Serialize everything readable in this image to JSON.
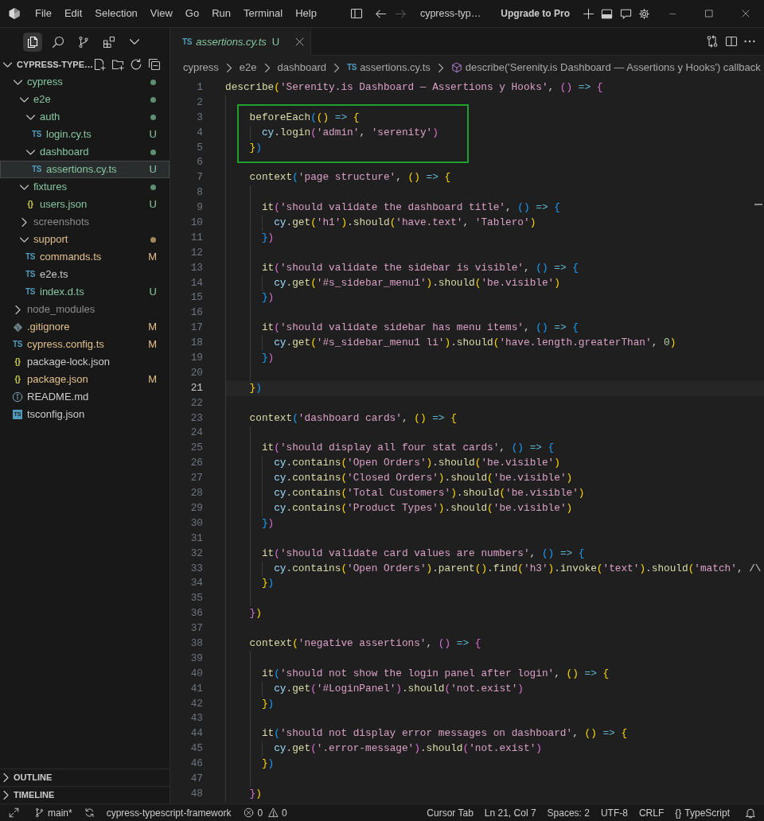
{
  "title_bar": {
    "menus": [
      "File",
      "Edit",
      "Selection",
      "View",
      "Go",
      "Run",
      "Terminal",
      "Help"
    ],
    "nav": [
      {
        "kind": "back",
        "disabled": false
      },
      {
        "kind": "forward",
        "disabled": true
      }
    ],
    "title": "cypress-typ…",
    "upgrade": "Upgrade to Pro"
  },
  "sidebar": {
    "views": [
      {
        "selected": true
      },
      {
        "selected": false
      },
      {
        "selected": false
      },
      {
        "selected": false
      }
    ],
    "section": {
      "title": "CYPRESS-TYPE…",
      "expanded": true
    },
    "tree": [
      {
        "name": "cypress",
        "kind": "folder",
        "expanded": true,
        "color": "#86c6a0",
        "dot": {
          "color": "#5f8f72"
        },
        "selected": false,
        "children": [
          {
            "name": "e2e",
            "kind": "folder",
            "expanded": true,
            "color": "#86c6a0",
            "dot": {
              "color": "#5f8f72"
            },
            "selected": false,
            "children": [
              {
                "name": "auth",
                "kind": "folder",
                "expanded": true,
                "color": "#86c6a0",
                "dot": {
                  "color": "#5f8f72"
                },
                "selected": false,
                "children": [
                  {
                    "name": "login.cy.ts",
                    "kind": "ts",
                    "glyph": "TS",
                    "color": "#86c6a0",
                    "badge": "U",
                    "selected": false
                  }
                ]
              },
              {
                "name": "dashboard",
                "kind": "folder",
                "expanded": true,
                "color": "#86c6a0",
                "dot": {
                  "color": "#5f8f72"
                },
                "selected": false,
                "children": [
                  {
                    "name": "assertions.cy.ts",
                    "kind": "ts",
                    "glyph": "TS",
                    "color": "#86c6a0",
                    "badge": "U",
                    "selected": true
                  }
                ]
              }
            ]
          },
          {
            "name": "fixtures",
            "kind": "folder",
            "expanded": true,
            "color": "#86c6a0",
            "dot": {
              "color": "#5f8f72"
            },
            "selected": false,
            "children": [
              {
                "name": "users.json",
                "kind": "json",
                "glyph": "{}",
                "color": "#86c6a0",
                "badge": "U",
                "selected": false
              }
            ]
          },
          {
            "name": "screenshots",
            "kind": "folder",
            "expanded": false,
            "color": "#8c8c8c",
            "selected": false
          },
          {
            "name": "support",
            "kind": "folder",
            "expanded": true,
            "color": "#e2c08d",
            "dot": {
              "color": "#a08a5c"
            },
            "selected": false,
            "children": [
              {
                "name": "commands.ts",
                "kind": "ts",
                "glyph": "TS",
                "color": "#e2c08d",
                "badge": "M",
                "selected": false
              },
              {
                "name": "e2e.ts",
                "kind": "ts",
                "glyph": "TS",
                "color": "#cccccc",
                "selected": false
              },
              {
                "name": "index.d.ts",
                "kind": "ts",
                "glyph": "TS",
                "color": "#86c6a0",
                "badge": "U",
                "selected": false
              }
            ]
          }
        ]
      },
      {
        "name": "node_modules",
        "kind": "folder",
        "expanded": false,
        "color": "#8c8c8c",
        "selected": false
      },
      {
        "name": ".gitignore",
        "kind": "git",
        "color": "#e2c08d",
        "badge": "M",
        "selected": false
      },
      {
        "name": "cypress.config.ts",
        "kind": "ts",
        "glyph": "TS",
        "color": "#e2c08d",
        "badge": "M",
        "selected": false
      },
      {
        "name": "package-lock.json",
        "kind": "json",
        "glyph": "{}",
        "color": "#cccccc",
        "selected": false
      },
      {
        "name": "package.json",
        "kind": "json",
        "glyph": "{}",
        "color": "#e2c08d",
        "badge": "M",
        "selected": false
      },
      {
        "name": "README.md",
        "kind": "info",
        "color": "#cccccc",
        "selected": false
      },
      {
        "name": "tsconfig.json",
        "kind": "tsconfig",
        "glyph": "TS",
        "color": "#cccccc",
        "selected": false
      }
    ],
    "panels": [
      {
        "title": "OUTLINE",
        "expanded": false
      },
      {
        "title": "TIMELINE",
        "expanded": false
      }
    ]
  },
  "editor": {
    "tabs": [
      {
        "glyph": "TS",
        "label": "assertions.cy.ts",
        "status": "U",
        "color": "#86c6a0",
        "preview": true,
        "selected": true
      }
    ],
    "breadcrumb": [
      {
        "kind": "folder",
        "label": "cypress"
      },
      {
        "kind": "folder",
        "label": "e2e"
      },
      {
        "kind": "folder",
        "label": "dashboard"
      },
      {
        "kind": "file",
        "glyph": "TS",
        "label": "assertions.cy.ts"
      },
      {
        "kind": "symbol",
        "label": "describe('Serenity.is Dashboard — Assertions y Hooks') callback"
      }
    ],
    "lines": [
      {
        "kind": "line",
        "number": "1",
        "text": "describe('Serenity.is Dashboard — Assertions y Hooks', () => {",
        "active": false
      },
      {
        "kind": "line",
        "number": "2",
        "active": false
      },
      {
        "kind": "frame",
        "lines": [
          {
            "number": "3",
            "text": "    beforeEach(() => {",
            "active": false
          },
          {
            "number": "4",
            "text": "      cy.login('admin', 'serenity')",
            "active": false
          },
          {
            "number": "5",
            "text": "    })",
            "active": false
          }
        ]
      },
      {
        "kind": "line",
        "number": "6",
        "active": false
      },
      {
        "kind": "line",
        "number": "7",
        "text": "    context('page structure', () => {",
        "active": false
      },
      {
        "kind": "line",
        "number": "8",
        "active": false
      },
      {
        "kind": "line",
        "number": "9",
        "text": "      it('should validate the dashboard title', () => {",
        "active": false
      },
      {
        "kind": "line",
        "number": "10",
        "text": "        cy.get('h1').should('have.text', 'Tablero')",
        "active": false
      },
      {
        "kind": "line",
        "number": "11",
        "text": "      })",
        "active": false
      },
      {
        "kind": "line",
        "number": "12",
        "active": false
      },
      {
        "kind": "line",
        "number": "13",
        "text": "      it('should validate the sidebar is visible', () => {",
        "active": false
      },
      {
        "kind": "line",
        "number": "14",
        "text": "        cy.get('#s_sidebar_menu1').should('be.visible')",
        "active": false
      },
      {
        "kind": "line",
        "number": "15",
        "text": "      })",
        "active": false
      },
      {
        "kind": "line",
        "number": "16",
        "active": false
      },
      {
        "kind": "line",
        "number": "17",
        "text": "      it('should validate sidebar has menu items', () => {",
        "active": false
      },
      {
        "kind": "line",
        "number": "18",
        "text": "        cy.get('#s_sidebar_menu1 li').should('have.length.greaterThan', 0)",
        "active": false
      },
      {
        "kind": "line",
        "number": "19",
        "text": "      })",
        "active": false
      },
      {
        "kind": "line",
        "number": "20",
        "active": false
      },
      {
        "kind": "line",
        "number": "21",
        "text": "    })",
        "active": true
      },
      {
        "kind": "line",
        "number": "22",
        "active": false
      },
      {
        "kind": "line",
        "number": "23",
        "text": "    context('dashboard cards', () => {",
        "active": false
      },
      {
        "kind": "line",
        "number": "24",
        "active": false
      },
      {
        "kind": "line",
        "number": "25",
        "text": "      it('should display all four stat cards', () => {",
        "active": false
      },
      {
        "kind": "line",
        "number": "26",
        "text": "        cy.contains('Open Orders').should('be.visible')",
        "active": false
      },
      {
        "kind": "line",
        "number": "27",
        "text": "        cy.contains('Closed Orders').should('be.visible')",
        "active": false
      },
      {
        "kind": "line",
        "number": "28",
        "text": "        cy.contains('Total Customers').should('be.visible')",
        "active": false
      },
      {
        "kind": "line",
        "number": "29",
        "text": "        cy.contains('Product Types').should('be.visible')",
        "active": false
      },
      {
        "kind": "line",
        "number": "30",
        "text": "      })",
        "active": false
      },
      {
        "kind": "line",
        "number": "31",
        "active": false
      },
      {
        "kind": "line",
        "number": "32",
        "text": "      it('should validate card values are numbers', () => {",
        "active": false
      },
      {
        "kind": "line",
        "number": "33",
        "text": "        cy.contains('Open Orders').parent().find('h3').invoke('text').should('match', /\\",
        "active": false
      },
      {
        "kind": "line",
        "number": "34",
        "text": "      })",
        "active": false
      },
      {
        "kind": "line",
        "number": "35",
        "active": false
      },
      {
        "kind": "line",
        "number": "36",
        "text": "    })",
        "active": false
      },
      {
        "kind": "line",
        "number": "37",
        "active": false
      },
      {
        "kind": "line",
        "number": "38",
        "text": "    context('negative assertions', () => {",
        "active": false
      },
      {
        "kind": "line",
        "number": "39",
        "active": false
      },
      {
        "kind": "line",
        "number": "40",
        "text": "      it('should not show the login panel after login', () => {",
        "active": false
      },
      {
        "kind": "line",
        "number": "41",
        "text": "        cy.get('#LoginPanel').should('not.exist')",
        "active": false
      },
      {
        "kind": "line",
        "number": "42",
        "text": "      })",
        "active": false
      },
      {
        "kind": "line",
        "number": "43",
        "active": false
      },
      {
        "kind": "line",
        "number": "44",
        "text": "      it('should not display error messages on dashboard', () => {",
        "active": false
      },
      {
        "kind": "line",
        "number": "45",
        "text": "        cy.get('.error-message').should('not.exist')",
        "active": false
      },
      {
        "kind": "line",
        "number": "46",
        "text": "      })",
        "active": false
      },
      {
        "kind": "line",
        "number": "47",
        "active": false
      },
      {
        "kind": "line",
        "number": "48",
        "text": "    })",
        "active": false
      }
    ]
  },
  "status_bar": {
    "branch": "main*",
    "workspace": "cypress-typescript-framework",
    "errors": "0",
    "warnings": "0",
    "items": [
      "Cursor Tab",
      "Ln 21, Col 7",
      "Spaces: 2",
      "UTF-8",
      "CRLF"
    ],
    "language_glyph": "{}",
    "language": "TypeScript"
  }
}
